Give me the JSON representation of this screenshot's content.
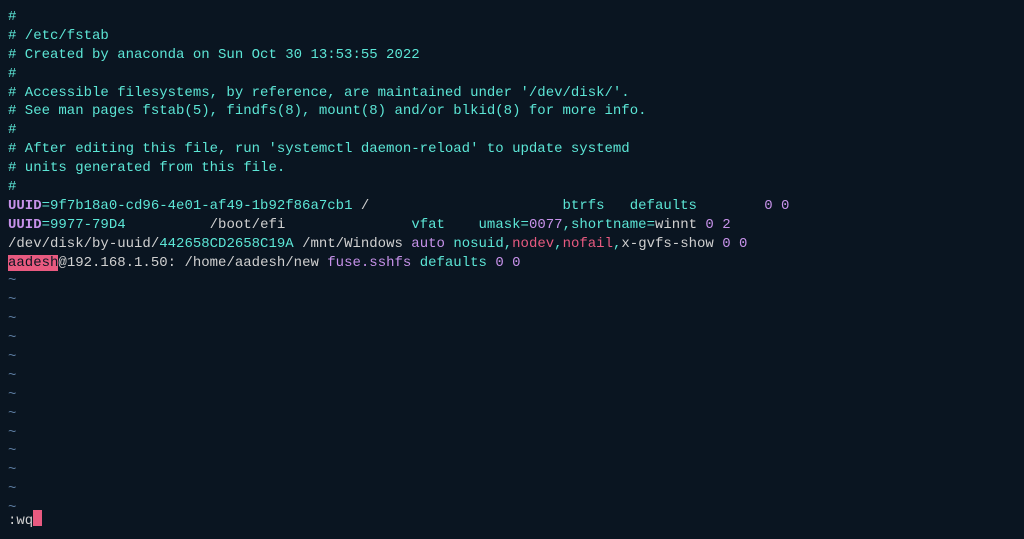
{
  "comments": {
    "l1": "#",
    "l2": "# /etc/fstab",
    "l3": "# Created by anaconda on Sun Oct 30 13:53:55 2022",
    "l4": "#",
    "l5": "# Accessible filesystems, by reference, are maintained under '/dev/disk/'.",
    "l6": "# See man pages fstab(5), findfs(8), mount(8) and/or blkid(8) for more info.",
    "l7": "#",
    "l8": "# After editing this file, run 'systemctl daemon-reload' to update systemd",
    "l9": "# units generated from this file.",
    "l10": "#"
  },
  "entry1": {
    "uuid_key": "UUID",
    "eq": "=",
    "uuid_val": "9f7b18a0-cd96-4e01-af49-1b92f86a7cb1",
    "mount": "/",
    "fstype": "btrfs",
    "options": "defaults",
    "dump": "0 0"
  },
  "entry2": {
    "uuid_key": "UUID",
    "eq": "=",
    "uuid_val": "9977-79D4",
    "mount": "/boot/efi",
    "fstype": "vfat",
    "opt_umask_key": "umask=",
    "opt_umask_val": "0077",
    "opt_rest": ",shortname=",
    "opt_winnt": "winnt",
    "dump": "0 2"
  },
  "entry3": {
    "devpath": "/dev/disk/by-uuid/",
    "devuuid": "442658CD2658C19A",
    "mount": "/mnt/Windows",
    "auto": "auto",
    "nosuid": "nosuid",
    "comma": ",",
    "nodev": "nodev",
    "nofail": "nofail",
    "xgvfs": "x-gvfs-show",
    "dump": "0 0"
  },
  "entry4": {
    "user": "aadesh",
    "host": "@192.168.1.50:",
    "path": "/home/aadesh/new",
    "fuse": "fuse.sshfs",
    "defaults": "defaults",
    "dump": "0 0"
  },
  "tilde": "~",
  "cmd": ":wq"
}
